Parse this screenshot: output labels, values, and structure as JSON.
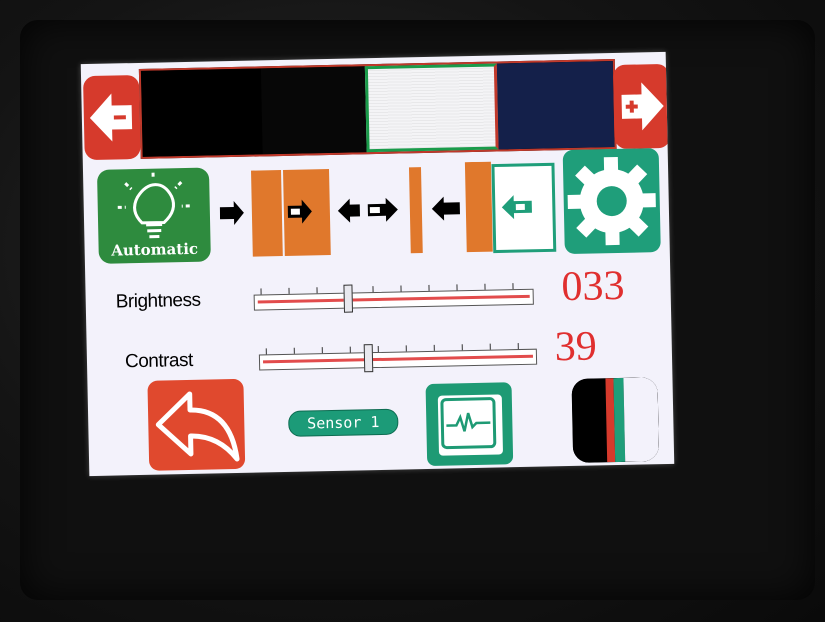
{
  "top_strip": {
    "prev_icon": "arrow-left-minus-icon",
    "next_icon": "arrow-right-plus-icon",
    "segments": [
      {
        "color": "#000000",
        "selected": false
      },
      {
        "color": "#000000",
        "selected": false
      },
      {
        "color": "#f4f4f6",
        "selected": true
      },
      {
        "color": "#14204a",
        "selected": false
      }
    ]
  },
  "mode": {
    "label": "Automatic",
    "icon": "lightbulb-icon"
  },
  "settings": {
    "icon": "gear-icon"
  },
  "brightness": {
    "label": "Brightness",
    "value": "033",
    "level_fraction": 0.33
  },
  "contrast": {
    "label": "Contrast",
    "value": "39",
    "level_fraction": 0.39
  },
  "bottom": {
    "back_icon": "undo-arrow-icon",
    "sensor_label": "Sensor 1",
    "monitor_icon": "waveform-monitor-icon",
    "color_icon": "color-sample-icon"
  },
  "colors": {
    "red": "#d63a2c",
    "green": "#2e8b3e",
    "teal": "#1f9e7a",
    "orange": "#e0782c",
    "value_red": "#e02f2f"
  }
}
